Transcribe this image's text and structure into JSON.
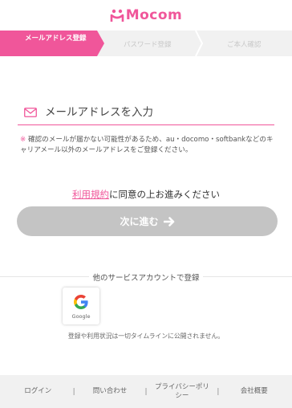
{
  "brand": {
    "name": "Mocom",
    "accent": "#f0569a"
  },
  "steps": [
    {
      "label": "メールアドレス登録",
      "active": true
    },
    {
      "label": "パスワード登録",
      "active": false
    },
    {
      "label": "ご本人確認",
      "active": false
    }
  ],
  "email": {
    "icon": "mail-icon",
    "placeholder": "メールアドレスを入力",
    "value": ""
  },
  "notice": {
    "mark": "※",
    "text": "確認のメールが届かない可能性があるため、au・docomo・softbankなどのキャリアメール以外のメールアドレスをご登録ください。"
  },
  "terms": {
    "link_text": "利用規約",
    "rest_text": "に同意の上お進みください"
  },
  "next_button": {
    "label": "次に進む",
    "icon": "arrow-right-icon"
  },
  "other_accounts": {
    "label": "他のサービスアカウントで登録",
    "google_label": "Google"
  },
  "privacy_note": "登録や利用状況は一切タイムラインに公開されません。",
  "footer": {
    "links": [
      "ログイン",
      "問い合わせ",
      "プライバシーポリシー",
      "会社概要"
    ],
    "separator": "|"
  }
}
